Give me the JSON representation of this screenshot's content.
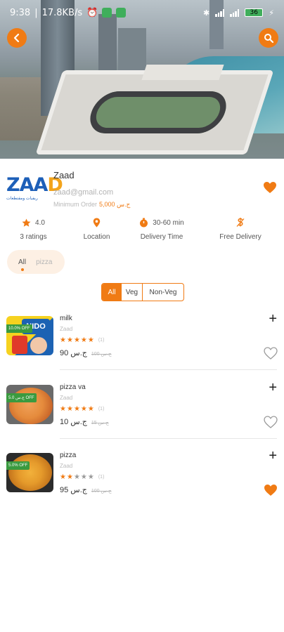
{
  "status_bar": {
    "time": "9:38",
    "network_speed": "17.8KB/s",
    "battery": "36"
  },
  "restaurant": {
    "name": "Zaad",
    "email": "zaad@gmail.com",
    "min_order_label": "Minimum Order",
    "min_order_value": "5,000 ج.س",
    "logo_text_main": "ZAAD",
    "logo_text_sub": "ريفيات ومقتطعات",
    "favorite": true
  },
  "stats": [
    {
      "icon": "star-icon",
      "value": "4.0",
      "label": "3 ratings"
    },
    {
      "icon": "location-pin-icon",
      "value": "",
      "label": "Location"
    },
    {
      "icon": "timer-icon",
      "value": "30-60 min",
      "label": "Delivery Time"
    },
    {
      "icon": "free-delivery-icon",
      "value": "",
      "label": "Free Delivery"
    }
  ],
  "categories": [
    "All",
    "pizza"
  ],
  "filter": {
    "options": [
      "All",
      "Veg",
      "Non-Veg"
    ],
    "selected": "All"
  },
  "items": [
    {
      "name": "milk",
      "restaurant": "Zaad",
      "rating": 5,
      "rating_count": "(1)",
      "price": "90 ج.س",
      "old_price": "100 ج.س",
      "discount": "10.0% OFF",
      "favorite": false
    },
    {
      "name": "pizza va",
      "restaurant": "Zaad",
      "rating": 5,
      "rating_count": "(1)",
      "price": "10 ج.س",
      "old_price": "15 ج.س",
      "discount": "5.0 ج.س OFF",
      "favorite": false
    },
    {
      "name": "pizza",
      "restaurant": "Zaad",
      "rating": 2,
      "rating_count": "(1)",
      "price": "95 ج.س",
      "old_price": "100 ج.س",
      "discount": "5.0% OFF",
      "favorite": true
    }
  ],
  "colors": {
    "accent": "#f07b14",
    "badge_green": "#3a9a3f"
  }
}
